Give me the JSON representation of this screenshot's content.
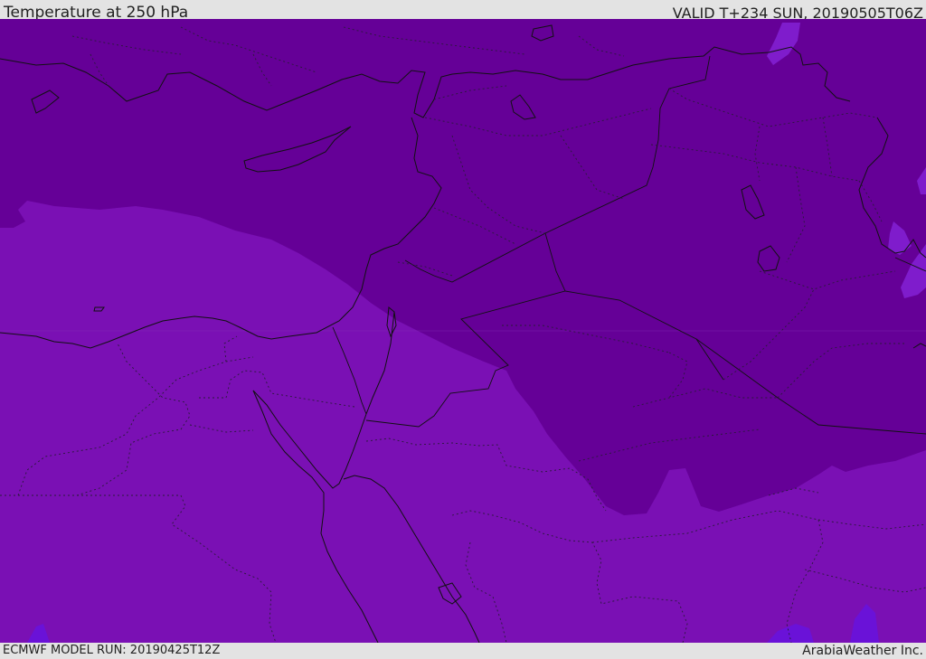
{
  "header": {
    "title": "Temperature at 250 hPa",
    "valid_time": "VALID T+234 SUN, 20190505T06Z"
  },
  "footer": {
    "model_run": "ECMWF MODEL RUN: 20190425T12Z",
    "credit": "ArabiaWeather Inc."
  },
  "colors": {
    "cold_band": "#650097",
    "warm_band": "#7a10b4",
    "warmest_patch": "#7f1ccc",
    "accent_patch": "#6a12d8",
    "coastline": "#111111",
    "border_dotted": "#2a1a3a"
  }
}
